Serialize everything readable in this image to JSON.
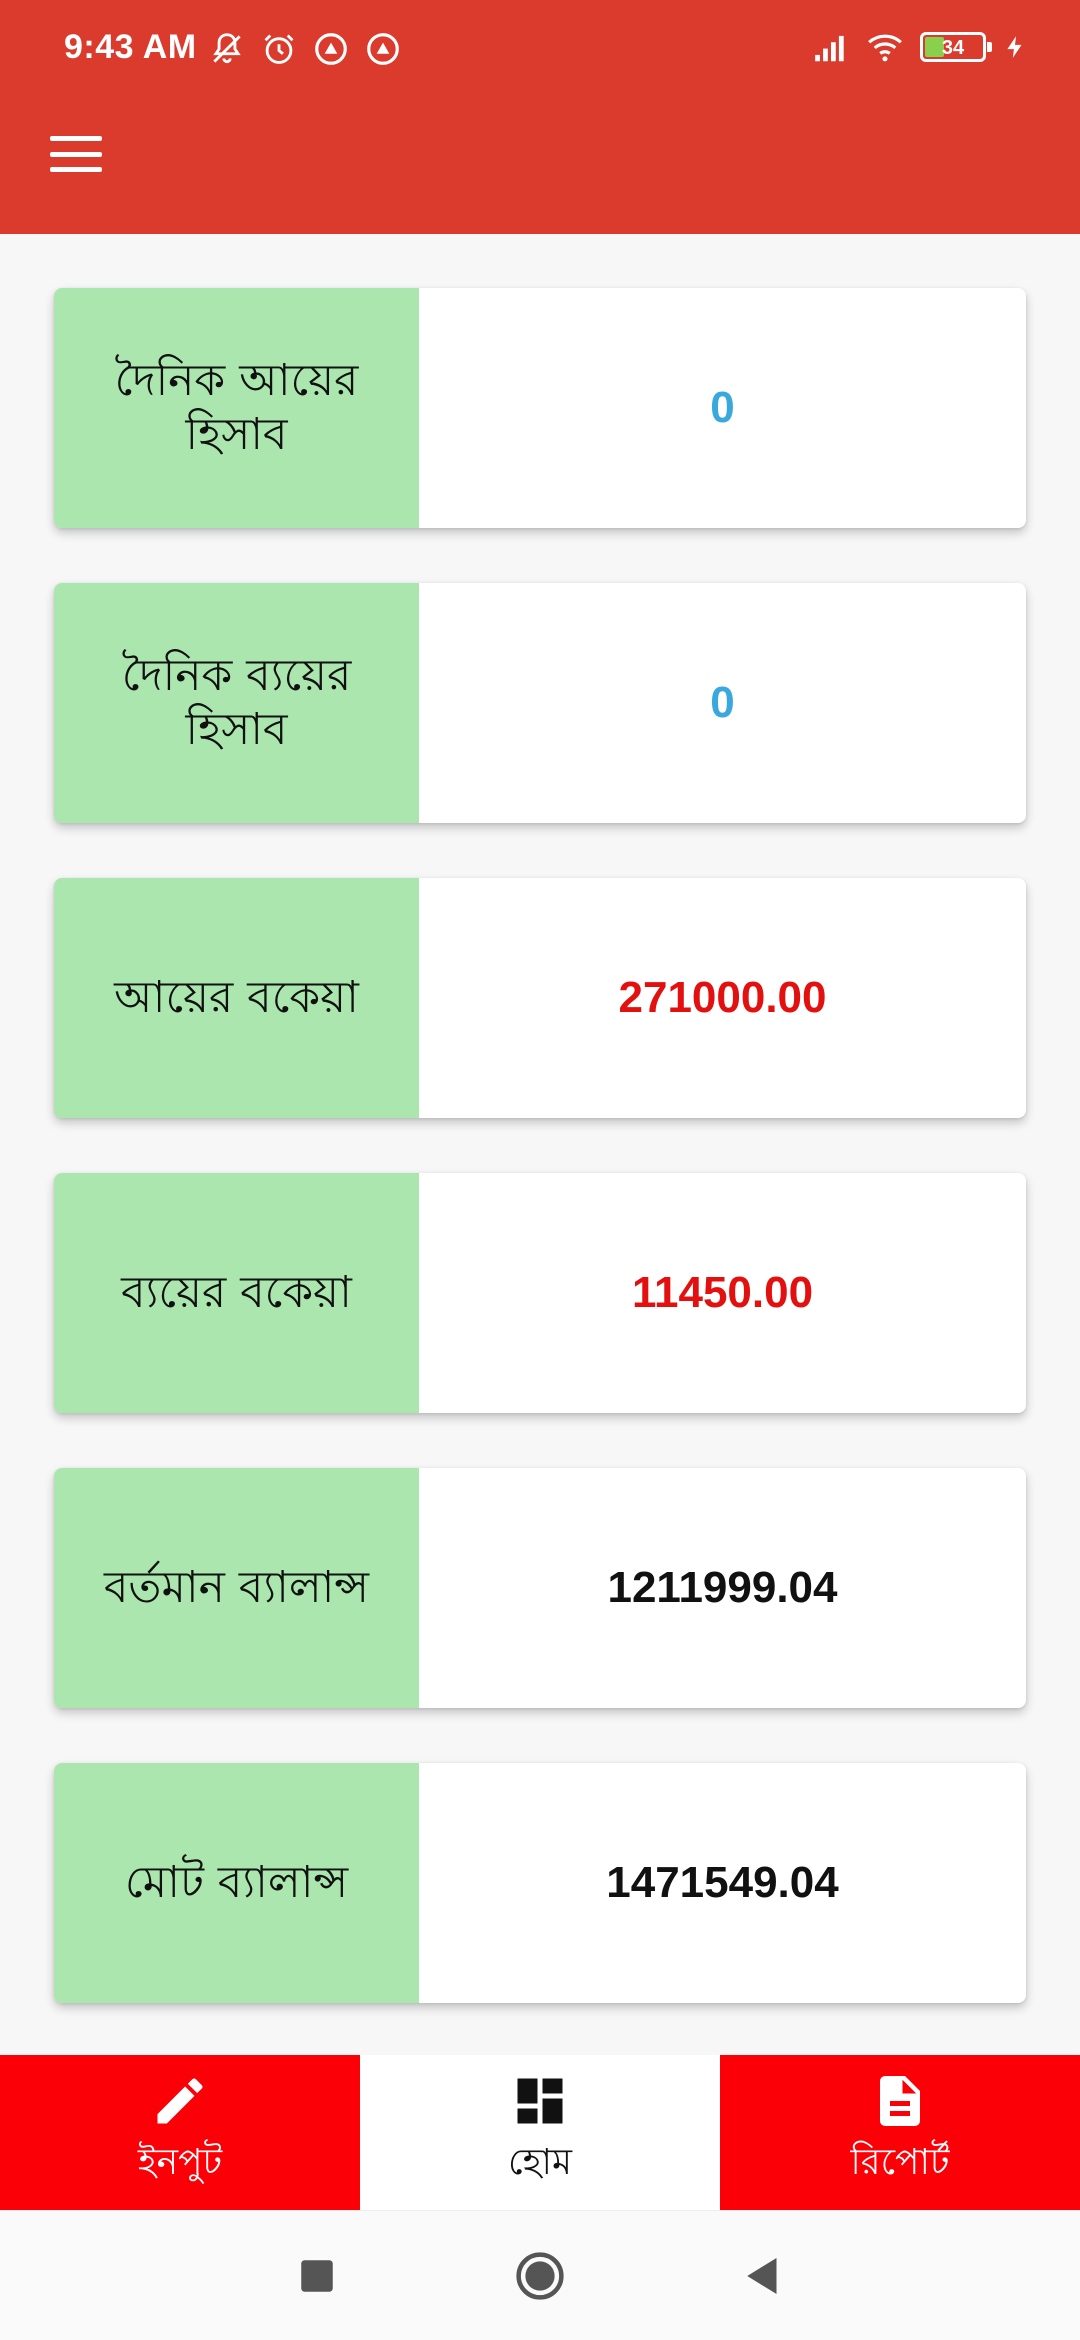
{
  "status_bar": {
    "time": "9:43 AM",
    "battery": "34",
    "left_icons": [
      "mute-icon",
      "alarm-icon",
      "app-notification-icon",
      "app-notification-icon"
    ],
    "right_icons": [
      "signal-icon",
      "wifi-icon",
      "battery-icon",
      "charging-icon"
    ]
  },
  "app_bar": {
    "menu_icon": "hamburger-menu-icon",
    "color": "#db3b2c"
  },
  "cards": [
    {
      "label": "দৈনিক আয়ের হিসাব",
      "value": "0",
      "value_color": "#3aa8dc"
    },
    {
      "label": "দৈনিক ব্যয়ের হিসাব",
      "value": "0",
      "value_color": "#3aa8dc"
    },
    {
      "label": "আয়ের বকেয়া",
      "value": "271000.00",
      "value_color": "#e31010"
    },
    {
      "label": "ব্যয়ের বকেয়া",
      "value": "11450.00",
      "value_color": "#e31010"
    },
    {
      "label": "বর্তমান ব্যালান্স",
      "value": "1211999.04",
      "value_color": "#111111"
    },
    {
      "label": "মোট ব্যালান্স",
      "value": "1471549.04",
      "value_color": "#111111"
    }
  ],
  "label_bg_color": "#aae6ae",
  "bottom_nav": {
    "items": [
      {
        "label": "ইনপুট",
        "icon": "pencil-icon",
        "active": false
      },
      {
        "label": "হোম",
        "icon": "dashboard-icon",
        "active": true
      },
      {
        "label": "রিপোর্ট",
        "icon": "document-icon",
        "active": false
      }
    ],
    "accent_color": "#fb0006"
  },
  "system_nav": {
    "buttons": [
      "recents-icon",
      "home-icon",
      "back-icon"
    ]
  }
}
